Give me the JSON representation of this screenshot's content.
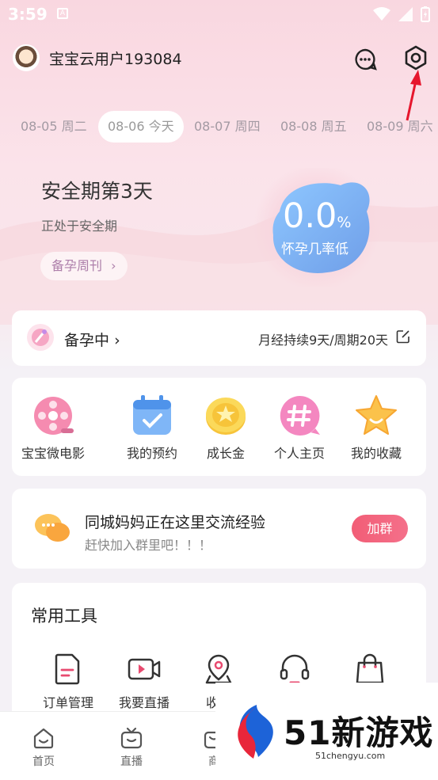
{
  "status_bar": {
    "time": "3:59",
    "sim": "A"
  },
  "header": {
    "username": "宝宝云用户193084"
  },
  "dates": [
    {
      "label": "08-05 周二",
      "active": false
    },
    {
      "label": "08-06 今天",
      "active": true
    },
    {
      "label": "08-07 周四",
      "active": false
    },
    {
      "label": "08-08 周五",
      "active": false
    },
    {
      "label": "08-09 周六",
      "active": false
    }
  ],
  "period": {
    "title": "安全期第3天",
    "subtitle": "正处于安全期",
    "weekly_button": "备孕周刊",
    "probability_value": "0.0",
    "probability_unit": "%",
    "probability_label": "怀孕几率低"
  },
  "status_card": {
    "label": "备孕中",
    "cycle_text": "月经持续9天/周期20天"
  },
  "menu": [
    {
      "label": "宝宝微电影",
      "icon": "film-reel-icon"
    },
    {
      "label": "我的预约",
      "icon": "calendar-icon"
    },
    {
      "label": "成长金",
      "icon": "coin-icon"
    },
    {
      "label": "个人主页",
      "icon": "hashtag-icon"
    },
    {
      "label": "我的收藏",
      "icon": "star-icon"
    }
  ],
  "group": {
    "title": "同城妈妈正在这里交流经验",
    "subtitle": "赶快加入群里吧！！！",
    "join_button": "加群"
  },
  "tools": {
    "title": "常用工具",
    "items": [
      {
        "label": "订单管理",
        "icon": "order-icon"
      },
      {
        "label": "我要直播",
        "icon": "video-camera-icon"
      },
      {
        "label": "收货",
        "icon": "location-icon"
      },
      {
        "label": "",
        "icon": "headset-icon"
      },
      {
        "label": "",
        "icon": "shopping-bag-icon"
      }
    ]
  },
  "bottom_nav": [
    {
      "label": "首页",
      "icon": "home-icon"
    },
    {
      "label": "直播",
      "icon": "tv-icon"
    },
    {
      "label": "商",
      "icon": "shop-icon"
    }
  ],
  "watermark": {
    "brand": "51新游戏",
    "url": "51chengyu.com"
  },
  "colors": {
    "accent_pink": "#f25d76",
    "blob_blue": "#7fb8f5",
    "header_bg": "#f9d7e0"
  }
}
